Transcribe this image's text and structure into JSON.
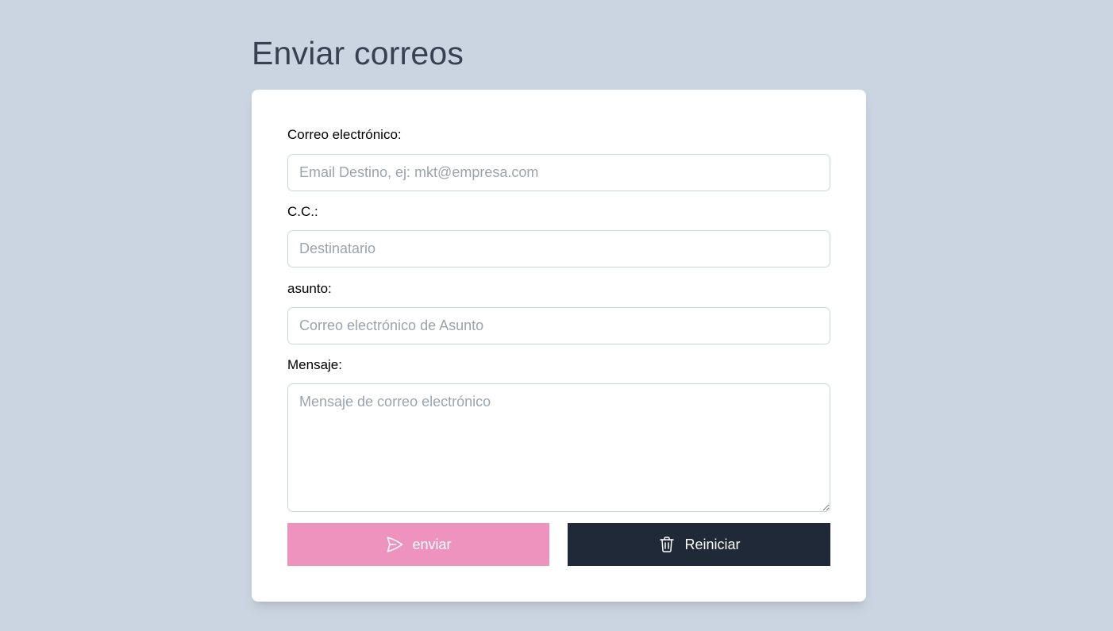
{
  "page": {
    "title": "Enviar correos"
  },
  "form": {
    "to": {
      "label": "Correo electrónico:",
      "value": "",
      "placeholder": "Email Destino, ej: mkt@empresa.com"
    },
    "cc": {
      "label": "C.C.:",
      "value": "",
      "placeholder": "Destinatario"
    },
    "subject": {
      "label": "asunto:",
      "value": "",
      "placeholder": "Correo electrónico de Asunto"
    },
    "message": {
      "label": "Mensaje:",
      "value": "",
      "placeholder": "Mensaje de correo electrónico"
    }
  },
  "actions": {
    "send": {
      "label": "enviar",
      "icon": "send-icon",
      "color": "#ed93bd"
    },
    "reset": {
      "label": "Reiniciar",
      "icon": "trash-icon",
      "color": "#1f2937"
    }
  },
  "colors": {
    "background": "#cbd5e1",
    "card": "#ffffff"
  }
}
